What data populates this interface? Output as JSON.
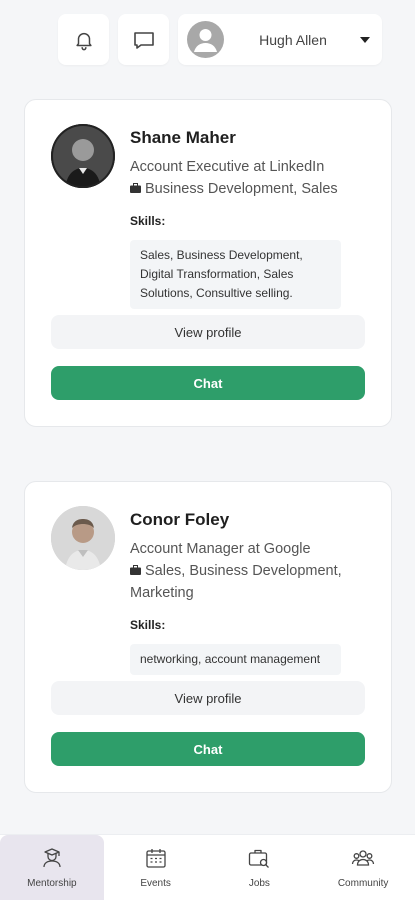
{
  "header": {
    "notifications_icon": "bell-icon",
    "messages_icon": "chat-bubble-icon",
    "user_name": "Hugh Allen",
    "dropdown_icon": "caret-down-icon"
  },
  "mentors": [
    {
      "name": "Shane Maher",
      "title": "Account Executive at LinkedIn",
      "department": "Business Development, Sales",
      "skills_label": "Skills:",
      "skills": "Sales, Business Development, Digital Transformation, Sales Solutions, Consultive selling.",
      "view_profile": "View profile",
      "chat": "Chat"
    },
    {
      "name": "Conor Foley",
      "title": "Account Manager at Google",
      "department": "Sales, Business Development, Marketing",
      "skills_label": "Skills:",
      "skills": "networking, account management",
      "view_profile": "View profile",
      "chat": "Chat"
    }
  ],
  "nav": [
    {
      "label": "Mentorship",
      "icon": "mentorship-icon",
      "active": true
    },
    {
      "label": "Events",
      "icon": "calendar-icon",
      "active": false
    },
    {
      "label": "Jobs",
      "icon": "briefcase-search-icon",
      "active": false
    },
    {
      "label": "Community",
      "icon": "people-icon",
      "active": false
    }
  ],
  "colors": {
    "accent": "#2e9e6a",
    "background": "#f5f6f8",
    "active_nav": "#e8e5ee"
  }
}
